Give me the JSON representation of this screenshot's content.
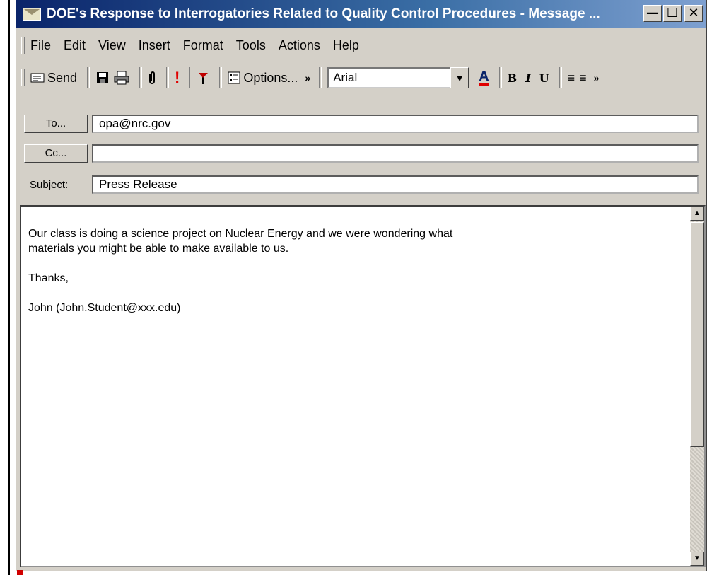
{
  "window": {
    "title": "DOE's Response to Interrogatories Related to Quality Control Procedures - Message ...",
    "controls": [
      "minimize",
      "maximize",
      "close"
    ]
  },
  "menubar": {
    "items": [
      "File",
      "Edit",
      "View",
      "Insert",
      "Format",
      "Tools",
      "Actions",
      "Help"
    ]
  },
  "toolbar": {
    "send_label": "Send",
    "options_label": "Options...",
    "font_name": "Arial",
    "icons": [
      "save-icon",
      "print-icon",
      "paperclip-icon",
      "importance-icon",
      "flag-icon",
      "options-icon",
      "font-color-icon",
      "bold-icon",
      "italic-icon",
      "underline-icon",
      "align-left-icon",
      "align-center-icon"
    ]
  },
  "header": {
    "to_button": "To...",
    "to_value": "opa@nrc.gov",
    "cc_button": "Cc...",
    "cc_value": "",
    "subject_label": "Subject:",
    "subject_value": "Press Release"
  },
  "message": {
    "line1": "Our class is doing a science project on Nuclear Energy and we were wondering what",
    "line2": "materials you might be able to make available to us.",
    "closing": "Thanks,",
    "signature": "John (John.Student@xxx.edu)"
  }
}
